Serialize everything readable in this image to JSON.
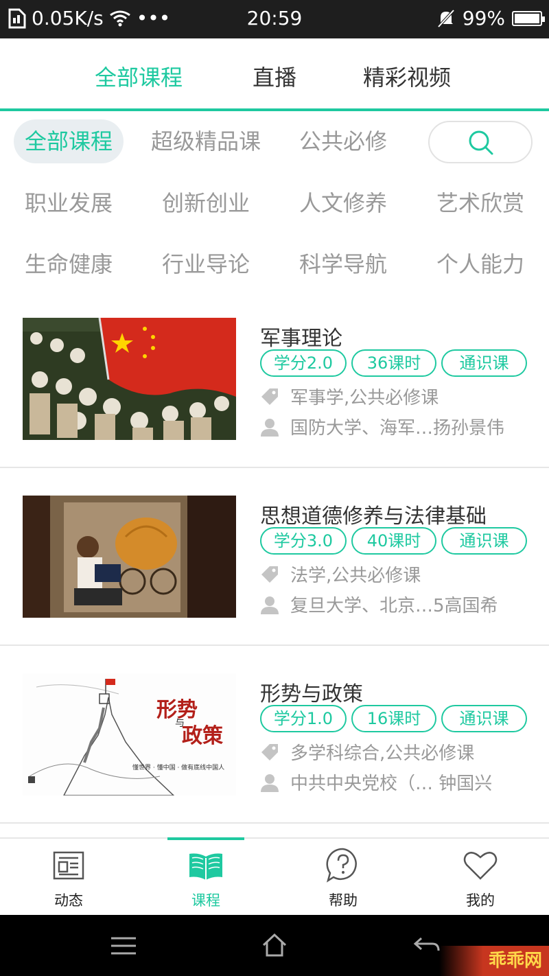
{
  "status_bar": {
    "speed": "0.05K/s",
    "dots": "•••",
    "time": "20:59",
    "battery": "99%",
    "battery_level": 0.99
  },
  "top_tabs": [
    {
      "label": "全部课程",
      "active": true
    },
    {
      "label": "直播",
      "active": false
    },
    {
      "label": "精彩视频",
      "active": false
    }
  ],
  "filter_row": [
    {
      "label": "全部课程",
      "active": true
    },
    {
      "label": "超级精品课"
    },
    {
      "label": "公共必修"
    }
  ],
  "categories_row1": [
    "职业发展",
    "创新创业",
    "人文修养",
    "艺术欣赏"
  ],
  "categories_row2": [
    "生命健康",
    "行业导论",
    "科学导航",
    "个人能力"
  ],
  "courses": [
    {
      "title": "军事理论",
      "badges": [
        "学分2.0",
        "36课时",
        "通识课"
      ],
      "tags": "军事学,公共必修课",
      "teacher": "国防大学、海军…扬孙景伟"
    },
    {
      "title": "思想道德修养与法律基础",
      "badges": [
        "学分3.0",
        "40课时",
        "通识课"
      ],
      "tags": "法学,公共必修课",
      "teacher": "复旦大学、北京…5高国希"
    },
    {
      "title": "形势与政策",
      "badges": [
        "学分1.0",
        "16课时",
        "通识课"
      ],
      "tags": "多学科综合,公共必修课",
      "teacher": "中共中央党校（…  钟国兴",
      "thumb_text": {
        "main_1": "形势",
        "connector": "与",
        "main_2": "政策",
        "sub": "懂世界 · 懂中国 · 做有底线中国人"
      }
    }
  ],
  "bottom_nav": [
    {
      "label": "动态",
      "icon": "newspaper-icon"
    },
    {
      "label": "课程",
      "icon": "book-icon",
      "active": true
    },
    {
      "label": "帮助",
      "icon": "help-icon"
    },
    {
      "label": "我的",
      "icon": "heart-icon"
    }
  ],
  "watermark": "乖乖网",
  "colors": {
    "accent": "#1ec9a0",
    "muted": "#999999",
    "chip_bg": "#e9eef1"
  }
}
